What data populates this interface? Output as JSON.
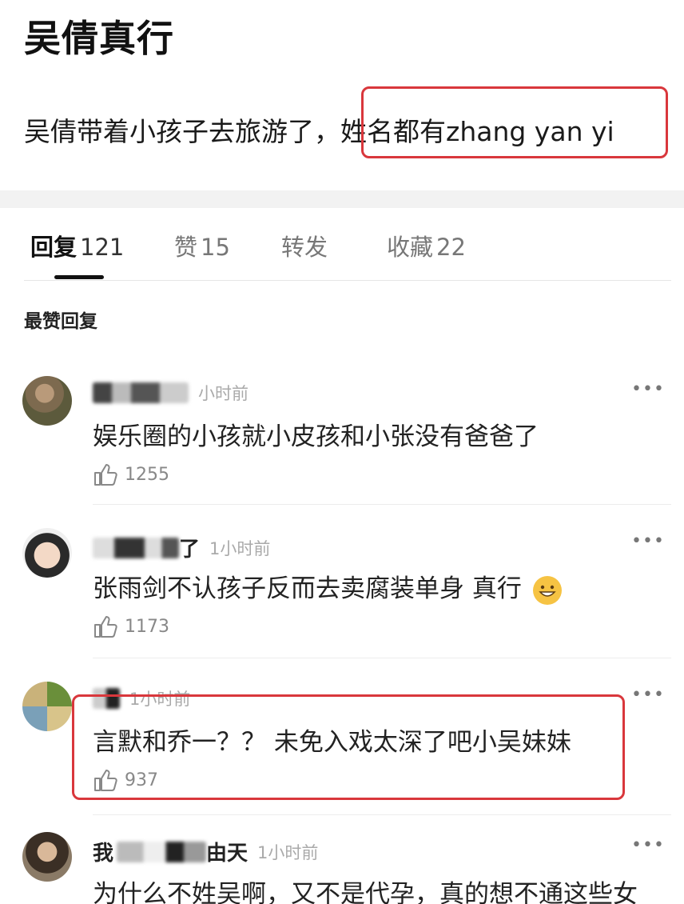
{
  "post": {
    "title": "吴倩真行",
    "text_before": "吴倩带着小孩子去旅游了，",
    "text_highlight": "姓名都有zhang yan yi"
  },
  "tabs": [
    {
      "label": "回复",
      "count": "121"
    },
    {
      "label": "赞",
      "count": "15"
    },
    {
      "label": "转发",
      "count": ""
    },
    {
      "label": "收藏",
      "count": "22"
    }
  ],
  "section_label": "最赞回复",
  "comments": [
    {
      "name_visible": "",
      "time": "小时前",
      "text": "娱乐圈的小孩就小皮孩和小张没有爸爸了",
      "likes": "1255"
    },
    {
      "name_visible": "了",
      "time": "1小时前",
      "text": "张雨剑不认孩子反而去卖腐装单身 真行",
      "likes": "1173"
    },
    {
      "name_visible": "",
      "time": "1小时前",
      "text": "言默和乔一？？ 未免入戏太深了吧小吴妹妹",
      "likes": "937"
    },
    {
      "name_prefix": "我",
      "name_visible": "由天",
      "time": "1小时前",
      "text": "为什么不姓吴啊，又不是代孕，真的想不通这些女",
      "likes": ""
    }
  ],
  "icons": {
    "more": "more-dots-icon",
    "like": "thumbs-up-icon",
    "emoji": "grinning-emoji-icon"
  },
  "colors": {
    "highlight_box": "#d9373c",
    "text": "#1a1a1a",
    "muted": "#888888"
  }
}
